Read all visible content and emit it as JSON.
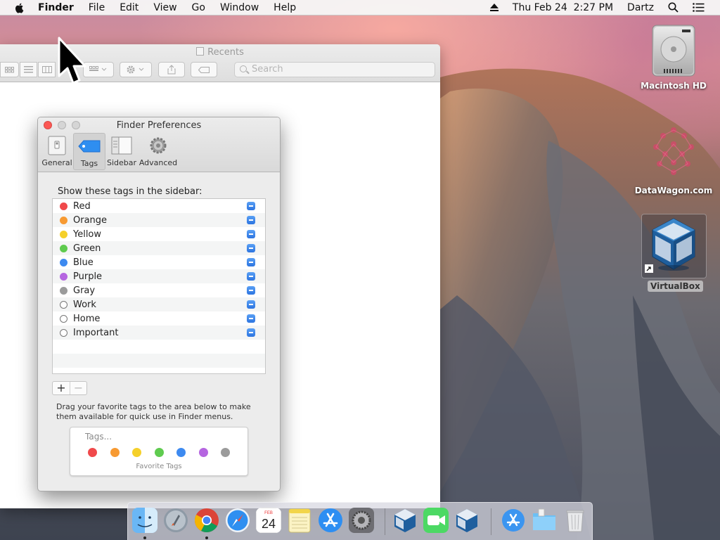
{
  "menubar": {
    "app_name": "Finder",
    "menus": [
      "File",
      "Edit",
      "View",
      "Go",
      "Window",
      "Help"
    ],
    "clock": "Thu Feb 24  2:27 PM",
    "user": "Dartz",
    "icons": [
      "apple-icon",
      "eject-icon",
      "search-icon",
      "list-icon"
    ]
  },
  "finder_window": {
    "title": "Recents",
    "search_placeholder": "Search"
  },
  "prefs": {
    "title": "Finder Preferences",
    "tabs": [
      {
        "label": "General",
        "icon": "general-icon"
      },
      {
        "label": "Tags",
        "icon": "tag-icon",
        "selected": true
      },
      {
        "label": "Sidebar",
        "icon": "sidebar-icon"
      },
      {
        "label": "Advanced",
        "icon": "gear-icon"
      }
    ],
    "section_label": "Show these tags in the sidebar:",
    "tags": [
      {
        "name": "Red",
        "color": "#f0494b",
        "checked": true
      },
      {
        "name": "Orange",
        "color": "#f79a32",
        "checked": true
      },
      {
        "name": "Yellow",
        "color": "#f5d02a",
        "checked": true
      },
      {
        "name": "Green",
        "color": "#5fcb4f",
        "checked": true
      },
      {
        "name": "Blue",
        "color": "#3d8af0",
        "checked": true
      },
      {
        "name": "Purple",
        "color": "#b565e0",
        "checked": true
      },
      {
        "name": "Gray",
        "color": "#9b9b9b",
        "checked": true
      },
      {
        "name": "Work",
        "color": "",
        "checked": true
      },
      {
        "name": "Home",
        "color": "",
        "checked": true
      },
      {
        "name": "Important",
        "color": "",
        "checked": true
      }
    ],
    "add_label": "+",
    "remove_label": "−",
    "hint": "Drag your favorite tags to the area below to make them available for quick use in Finder menus.",
    "favorites_placeholder": "Tags...",
    "favorites_colors": [
      "#f0494b",
      "#f79a32",
      "#f5d02a",
      "#5fcb4f",
      "#3d8af0",
      "#b565e0",
      "#9b9b9b"
    ],
    "favorites_caption": "Favorite Tags"
  },
  "desktop": {
    "icons": [
      {
        "label": "Macintosh HD",
        "icon": "hard-drive-icon"
      },
      {
        "label": "DataWagon.com",
        "icon": "datawagon-icon"
      },
      {
        "label": "VirtualBox",
        "icon": "virtualbox-icon",
        "selected": true
      }
    ]
  },
  "dock": {
    "apps": [
      {
        "name": "Finder",
        "icon": "finder-icon",
        "running": true
      },
      {
        "name": "Launchpad",
        "icon": "launchpad-icon",
        "running": false
      },
      {
        "name": "Chrome",
        "icon": "chrome-icon",
        "running": true
      },
      {
        "name": "Safari",
        "icon": "safari-icon",
        "running": false
      },
      {
        "name": "Calendar",
        "icon": "calendar-icon",
        "running": false,
        "day": "24",
        "month": "FEB"
      },
      {
        "name": "Notes",
        "icon": "notes-icon",
        "running": false
      },
      {
        "name": "App Store",
        "icon": "app-store-icon",
        "running": false
      },
      {
        "name": "System Preferences",
        "icon": "system-preferences-icon",
        "running": false
      },
      {
        "name": "VirtualBox",
        "icon": "virtualbox-icon",
        "running": false
      },
      {
        "name": "FaceTime",
        "icon": "facetime-icon",
        "running": false
      },
      {
        "name": "VirtualBox",
        "icon": "virtualbox-icon",
        "running": false
      },
      {
        "name": "Applications",
        "icon": "applications-folder-icon",
        "running": false
      },
      {
        "name": "Downloads",
        "icon": "downloads-folder-icon",
        "running": false
      },
      {
        "name": "Trash",
        "icon": "trash-icon",
        "running": false
      }
    ]
  }
}
